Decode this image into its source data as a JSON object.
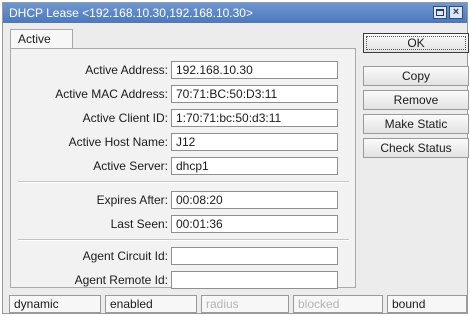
{
  "window": {
    "title": "DHCP Lease <192.168.10.30,192.168.10.30>"
  },
  "tabs": [
    {
      "label": "Active"
    }
  ],
  "fields": {
    "active_address": {
      "label": "Active Address:",
      "value": "192.168.10.30"
    },
    "active_mac": {
      "label": "Active MAC Address:",
      "value": "70:71:BC:50:D3:11"
    },
    "active_client_id": {
      "label": "Active Client ID:",
      "value": "1:70:71:bc:50:d3:11"
    },
    "active_host_name": {
      "label": "Active Host Name:",
      "value": "J12"
    },
    "active_server": {
      "label": "Active Server:",
      "value": "dhcp1"
    },
    "expires_after": {
      "label": "Expires After:",
      "value": "00:08:20"
    },
    "last_seen": {
      "label": "Last Seen:",
      "value": "00:01:36"
    },
    "agent_circuit_id": {
      "label": "Agent Circuit Id:",
      "value": ""
    },
    "agent_remote_id": {
      "label": "Agent Remote Id:",
      "value": ""
    }
  },
  "buttons": {
    "ok": "OK",
    "copy": "Copy",
    "remove": "Remove",
    "make_static": "Make Static",
    "check_status": "Check Status"
  },
  "status_bar": {
    "state": "dynamic",
    "enabled": "enabled",
    "radius": "radius",
    "blocked": "blocked",
    "lease_status": "bound"
  },
  "colors": {
    "titlebar": "#4c78bd",
    "disabled_text": "#b4b4b4"
  }
}
